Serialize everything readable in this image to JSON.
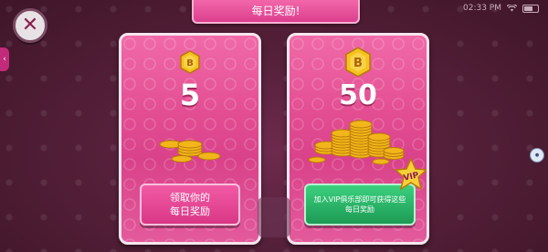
{
  "status_bar": {
    "time": "02:33 PM"
  },
  "title": "每日奖励!",
  "cards": [
    {
      "amount": "5",
      "button_label_line1": "领取你的",
      "button_label_line2": "每日奖励"
    },
    {
      "amount": "50",
      "button_label": "加入VIP俱乐部即可获得这些每日奖励",
      "vip_badge": "VIP"
    }
  ],
  "coin_glyph": "B",
  "icons": [
    "close-icon",
    "coin-icon",
    "wifi-icon",
    "battery-icon",
    "vip-star-icon",
    "arrow-left-icon"
  ],
  "colors": {
    "card_pink": "#e24c91",
    "vip_green": "#2bb566",
    "coin_gold": "#f2b61b",
    "background": "#552039"
  }
}
